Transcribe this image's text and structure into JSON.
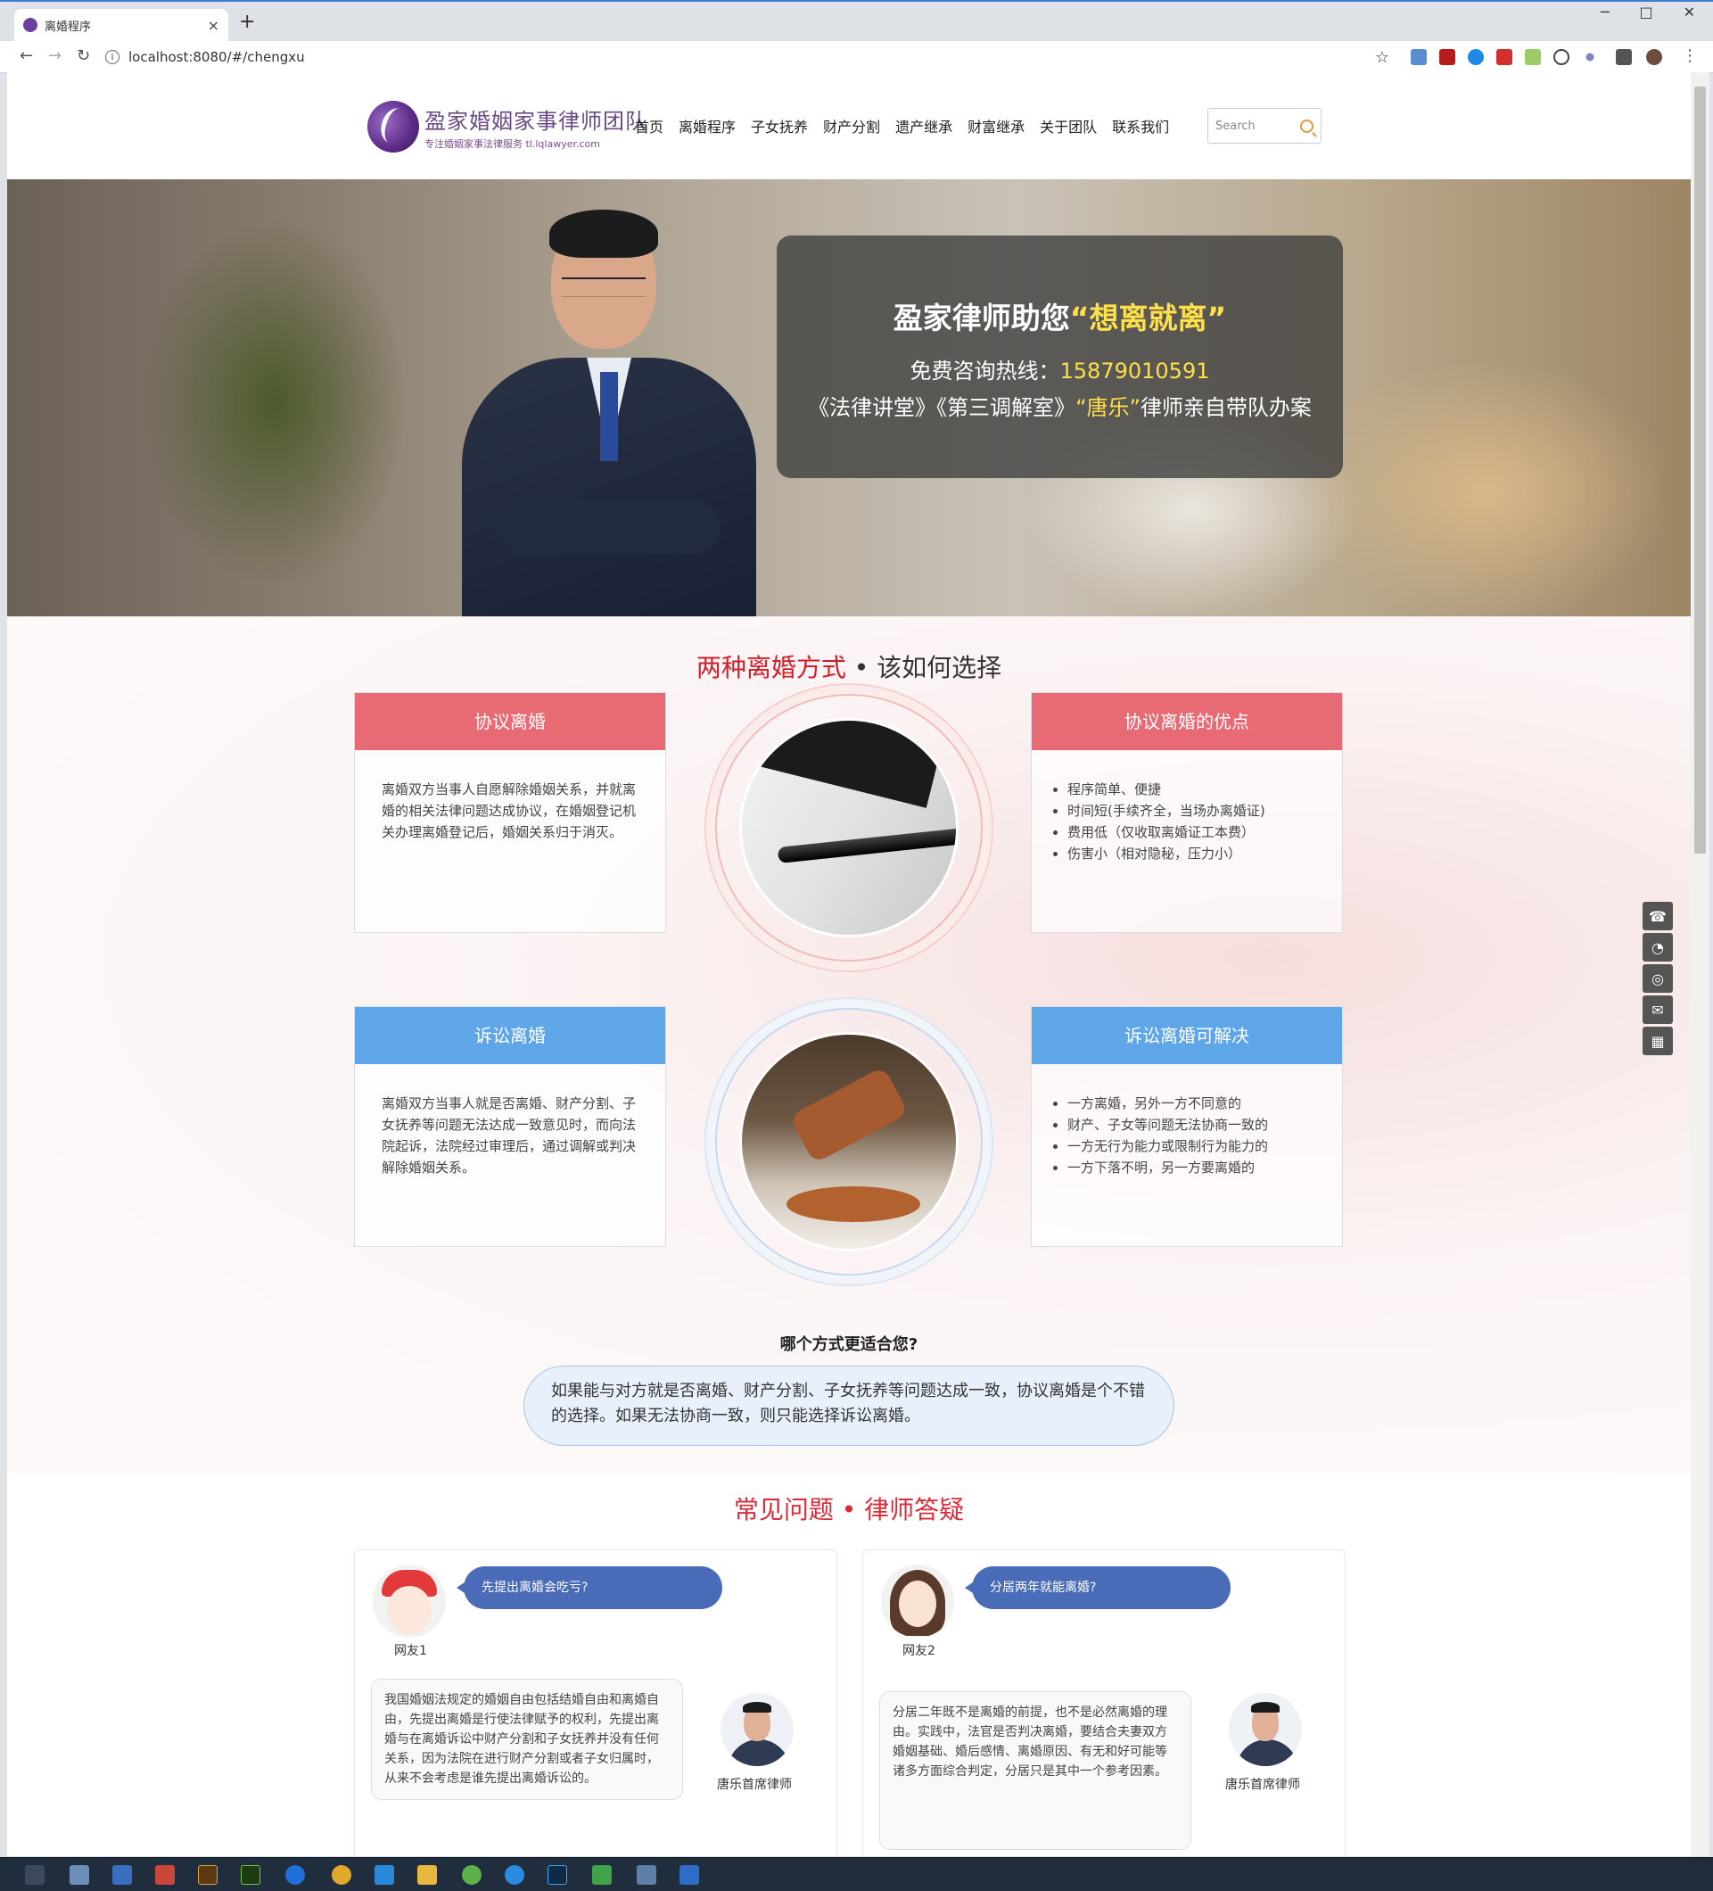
{
  "browser": {
    "tab_title": "离婚程序",
    "new_tab": "+",
    "url": "localhost:8080/#/chengxu",
    "info": "i",
    "star": "☆",
    "more": "⋮",
    "minimize": "─",
    "maximize": "□",
    "close": "✕",
    "tab_close": "×",
    "back": "←",
    "forward": "→",
    "reload": "↻"
  },
  "header": {
    "logo_main": "盈家婚姻家事律师团队",
    "logo_sub": "专注婚姻家事法律服务 tl.lqlawyer.com",
    "menu": [
      "首页",
      "离婚程序",
      "子女抚养",
      "财产分割",
      "遗产继承",
      "财富继承",
      "关于团队",
      "联系我们"
    ],
    "search_placeholder": "Search"
  },
  "hero": {
    "headline_prefix": "盈家律师助您",
    "headline_highlight": "“想离就离”",
    "hotline_label": "免费咨询热线：",
    "hotline_number": "15879010591",
    "line3_prefix": "《法律讲堂》《第三调解室》",
    "line3_highlight": "“唐乐”",
    "line3_suffix": "律师亲自带队办案"
  },
  "methods": {
    "title_red": "两种离婚方式",
    "title_rest": " • 该如何选择",
    "card1_title": "协议离婚",
    "card1_body": "离婚双方当事人自愿解除婚姻关系，并就离婚的相关法律问题达成协议，在婚姻登记机关办理离婚登记后，婚姻关系归于消灭。",
    "card2_title": "协议离婚的优点",
    "card2_items": [
      "程序简单、便捷",
      "时间短(手续齐全，当场办离婚证)",
      "费用低（仅收取离婚证工本费）",
      "伤害小（相对隐秘，压力小）"
    ],
    "card3_title": "诉讼离婚",
    "card3_body": "离婚双方当事人就是否离婚、财产分割、子女抚养等问题无法达成一致意见时，而向法院起诉，法院经过审理后，通过调解或判决解除婚姻关系。",
    "card4_title": "诉讼离婚可解决",
    "card4_items": [
      "一方离婚，另外一方不同意的",
      "财产、子女等问题无法协商一致的",
      "一方无行为能力或限制行为能力的",
      "一方下落不明，另一方要离婚的"
    ],
    "question": "哪个方式更适合您?",
    "answer": "如果能与对方就是否离婚、财产分割、子女抚养等问题达成一致，协议离婚是个不错的选择。如果无法协商一致，则只能选择诉讼离婚。"
  },
  "faq": {
    "title": "常见问题 • 律师答疑",
    "items": [
      {
        "user": "网友1",
        "question": "先提出离婚会吃亏?",
        "answer": "我国婚姻法规定的婚姻自由包括结婚自由和离婚自由，先提出离婚是行使法律赋予的权利，先提出离婚与在离婚诉讼中财产分割和子女抚养并没有任何关系，因为法院在进行财产分割或者子女归属时，从来不会考虑是谁先提出离婚诉讼的。",
        "lawyer": "唐乐首席律师"
      },
      {
        "user": "网友2",
        "question": "分居两年就能离婚?",
        "answer": "分居二年既不是离婚的前提，也不是必然离婚的理由。实践中，法官是否判决离婚，要结合夫妻双方婚姻基础、婚后感情、离婚原因、有无和好可能等诸多方面综合判定，分居只是其中一个参考因素。",
        "lawyer": "唐乐首席律师"
      }
    ]
  },
  "float_icons": [
    "phone-icon",
    "qq-icon",
    "wechat-icon",
    "message-icon",
    "qrcode-icon"
  ]
}
